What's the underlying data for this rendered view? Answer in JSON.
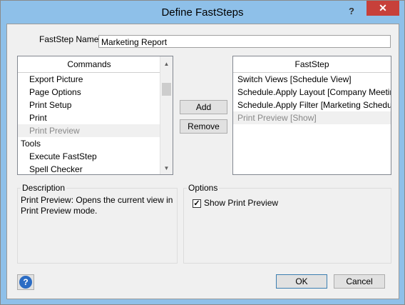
{
  "window": {
    "title": "Define FastSteps",
    "help_glyph": "?",
    "close_glyph": "✕"
  },
  "name_field": {
    "label": "FastStep Name:",
    "value": "Marketing Report"
  },
  "commands": {
    "header": "Commands",
    "items": [
      {
        "label": "Export Picture",
        "indent": true,
        "selected": false
      },
      {
        "label": "Page Options",
        "indent": true,
        "selected": false
      },
      {
        "label": "Print Setup",
        "indent": true,
        "selected": false
      },
      {
        "label": "Print",
        "indent": true,
        "selected": false
      },
      {
        "label": "Print Preview",
        "indent": true,
        "selected": true
      },
      {
        "label": "Tools",
        "indent": false,
        "selected": false
      },
      {
        "label": "Execute FastStep",
        "indent": true,
        "selected": false
      },
      {
        "label": "Spell Checker",
        "indent": true,
        "selected": false
      }
    ]
  },
  "buttons": {
    "add": "Add",
    "remove": "Remove",
    "ok": "OK",
    "cancel": "Cancel"
  },
  "faststep": {
    "header": "FastStep",
    "items": [
      {
        "label": "Switch Views [Schedule View]",
        "selected": false
      },
      {
        "label": "Schedule.Apply Layout [Company Meeting...",
        "selected": false
      },
      {
        "label": "Schedule.Apply Filter [Marketing Schedule]",
        "selected": false
      },
      {
        "label": "Print Preview [Show]",
        "selected": true
      }
    ]
  },
  "description": {
    "title": "Description",
    "text_line1": "Print Preview: Opens the current view in",
    "text_line2": "Print Preview mode."
  },
  "options": {
    "title": "Options",
    "show_print_preview_label": "Show Print Preview",
    "show_print_preview_checked": true,
    "check_glyph": "✓"
  },
  "help_button_glyph": "?"
}
